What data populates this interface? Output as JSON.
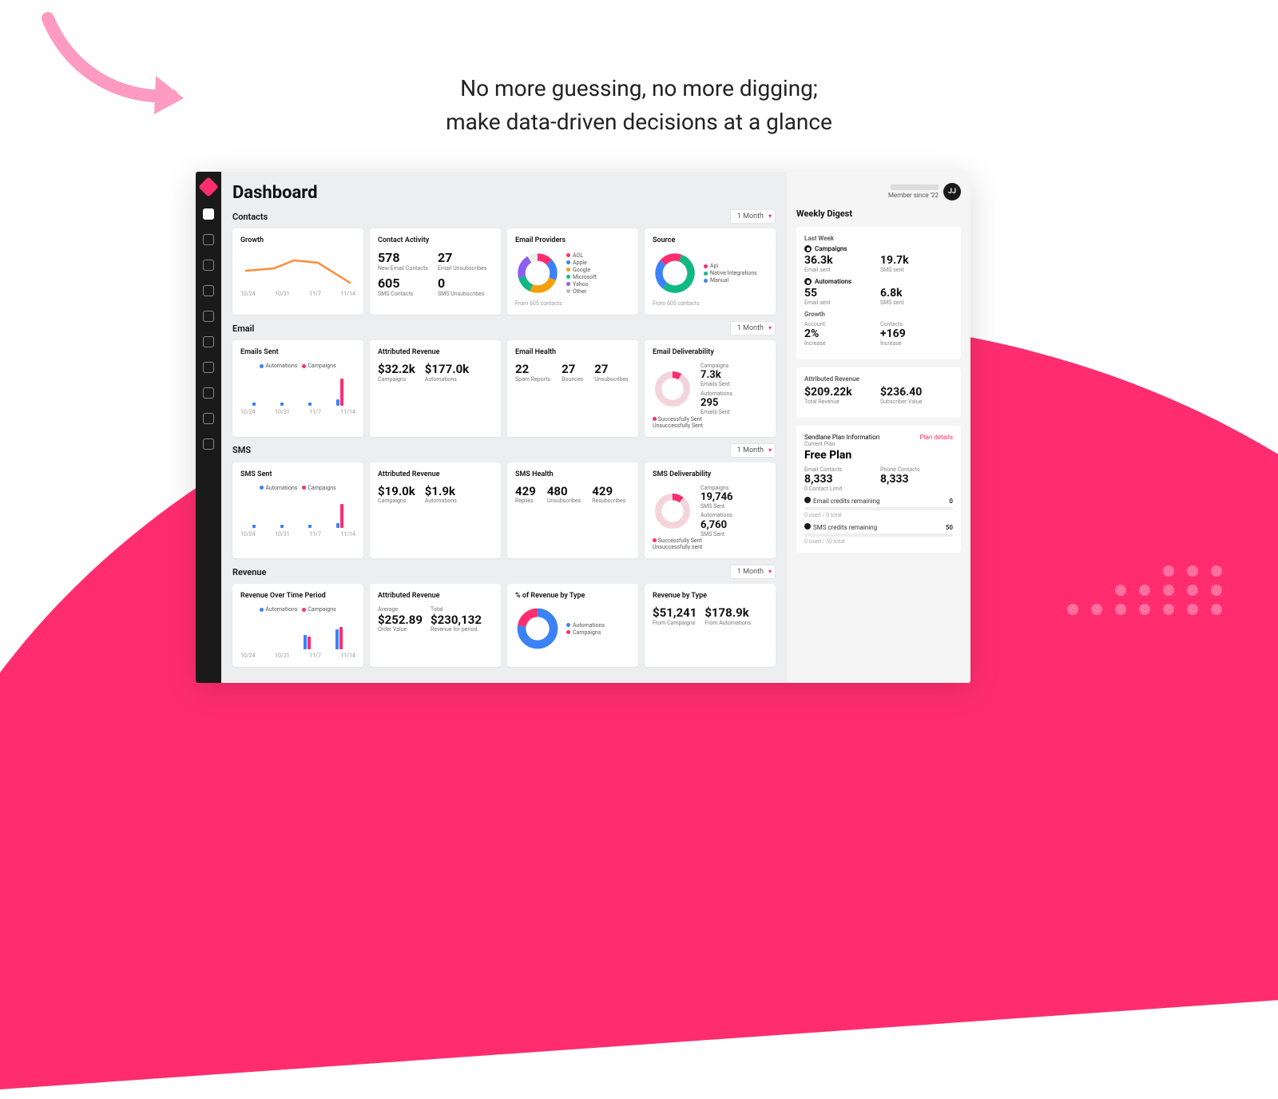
{
  "marketing": {
    "tagline_l1": "No more guessing, no more digging;",
    "tagline_l2": "make data-driven decisions at a glance"
  },
  "app": {
    "title": "Dashboard",
    "user": {
      "member_since": "Member since '22",
      "initials": "JJ"
    },
    "period_options": {
      "selected": "1 Month"
    },
    "sections": {
      "contacts": {
        "title": "Contacts",
        "growth": {
          "title": "Growth",
          "x": [
            "10/24",
            "10/31",
            "11/7",
            "11/14"
          ]
        },
        "activity": {
          "title": "Contact Activity",
          "stats": [
            {
              "v": "578",
              "l": "New Email Contacts"
            },
            {
              "v": "27",
              "l": "Email Unsubscribes"
            },
            {
              "v": "605",
              "l": "SMS Contacts"
            },
            {
              "v": "0",
              "l": "SMS Unsubscribes"
            }
          ]
        },
        "providers": {
          "title": "Email Providers",
          "legend": [
            "AOL",
            "Apple",
            "Google",
            "Microsoft",
            "Yahoo",
            "Other"
          ],
          "from": "From 605 contacts"
        },
        "source": {
          "title": "Source",
          "legend": [
            "Api",
            "Native Integrations",
            "Manual"
          ],
          "from": "From 605 contacts"
        }
      },
      "email": {
        "title": "Email",
        "sent": {
          "title": "Emails Sent",
          "legend": [
            "Automations",
            "Campaigns"
          ],
          "x": [
            "10/24",
            "10/31",
            "11/7",
            "11/14"
          ]
        },
        "revenue": {
          "title": "Attributed Revenue",
          "stats": [
            {
              "v": "$32.2k",
              "l": "Campaigns"
            },
            {
              "v": "$177.0k",
              "l": "Automations"
            }
          ]
        },
        "health": {
          "title": "Email Health",
          "stats": [
            {
              "v": "22",
              "l": "Spam Reports"
            },
            {
              "v": "27",
              "l": "Bounces"
            },
            {
              "v": "27",
              "l": "Unsubscribes"
            }
          ]
        },
        "deliv": {
          "title": "Email Deliverability",
          "legend": [
            "Successfully Sent",
            "Unsuccessfully Sent"
          ],
          "stats": [
            {
              "h": "Campaigns",
              "v": "7.3k",
              "l": "Emails Sent"
            },
            {
              "h": "Automations",
              "v": "295",
              "l": "Emails Sent"
            }
          ]
        }
      },
      "sms": {
        "title": "SMS",
        "sent": {
          "title": "SMS Sent",
          "legend": [
            "Automations",
            "Campaigns"
          ],
          "x": [
            "10/24",
            "10/31",
            "11/7",
            "11/14"
          ]
        },
        "revenue": {
          "title": "Attributed Revenue",
          "stats": [
            {
              "v": "$19.0k",
              "l": "Campaigns"
            },
            {
              "v": "$1.9k",
              "l": "Automations"
            }
          ]
        },
        "health": {
          "title": "SMS Health",
          "stats": [
            {
              "v": "429",
              "l": "Replies"
            },
            {
              "v": "480",
              "l": "Unsubscribes"
            },
            {
              "v": "429",
              "l": "Resubscribes"
            }
          ]
        },
        "deliv": {
          "title": "SMS Deliverability",
          "legend": [
            "Successfully Sent",
            "Unsuccessfully sent"
          ],
          "stats": [
            {
              "h": "Campaigns",
              "v": "19,746",
              "l": "SMS Sent"
            },
            {
              "h": "Automations",
              "v": "6,760",
              "l": "SMS Sent"
            }
          ]
        }
      },
      "revenue": {
        "title": "Revenue",
        "over_time": {
          "title": "Revenue Over Time Period",
          "legend": [
            "Automations",
            "Campaigns"
          ],
          "x": [
            "10/24",
            "10/31",
            "11/7",
            "11/14"
          ]
        },
        "attributed": {
          "title": "Attributed Revenue",
          "stats": [
            {
              "h": "Average",
              "v": "$252.89",
              "l": "Order Value"
            },
            {
              "h": "Total",
              "v": "$230,132",
              "l": "Revenue for period"
            }
          ]
        },
        "pct_type": {
          "title": "% of Revenue by Type",
          "legend": [
            "Automations",
            "Campaigns"
          ]
        },
        "by_type": {
          "title": "Revenue by Type",
          "stats": [
            {
              "v": "$51,241",
              "l": "From Campaigns"
            },
            {
              "v": "$178.9k",
              "l": "From Automations"
            }
          ]
        }
      }
    },
    "rail": {
      "digest_title": "Weekly Digest",
      "last_week": "Last Week",
      "campaigns": "Campaigns",
      "camp_stats": [
        {
          "v": "36.3k",
          "l": "Email sent"
        },
        {
          "v": "19.7k",
          "l": "SMS sent"
        }
      ],
      "automations": "Automations",
      "auto_stats": [
        {
          "v": "55",
          "l": "Email sent"
        },
        {
          "v": "6.8k",
          "l": "SMS sent"
        }
      ],
      "growth": "Growth",
      "growth_stats": [
        {
          "h": "Account",
          "v": "2%",
          "l": "Increase"
        },
        {
          "h": "Contacts",
          "v": "+169",
          "l": "Increase"
        }
      ],
      "attr_rev": "Attributed Revenue",
      "attr_stats": [
        {
          "v": "$209.22k",
          "l": "Total Revenue"
        },
        {
          "v": "$236.40",
          "l": "Subscriber Value"
        }
      ],
      "plan": {
        "head": "Sendlane Plan Information",
        "details": "Plan details",
        "current": "Current Plan",
        "name": "Free Plan",
        "cols": [
          {
            "h": "Email Contacts",
            "v": "8,333",
            "l": "0 Contact Limit"
          },
          {
            "h": "Phone Contacts",
            "v": "8,333",
            "l": ""
          }
        ],
        "email_credits": {
          "label": "Email credits remaining",
          "v": "0",
          "sub": "0 used / 0 total"
        },
        "sms_credits": {
          "label": "SMS credits remaining",
          "v": "50",
          "sub": "0 used / 50 total"
        }
      }
    }
  },
  "chart_data": [
    {
      "type": "line",
      "title": "Growth",
      "x": [
        "10/24",
        "10/31",
        "11/7",
        "11/14"
      ],
      "values": [
        60,
        62,
        72,
        40
      ],
      "ylim": [
        0,
        100
      ]
    },
    {
      "type": "pie",
      "title": "Email Providers",
      "categories": [
        "AOL",
        "Apple",
        "Google",
        "Microsoft",
        "Yahoo",
        "Other"
      ],
      "values": [
        12,
        18,
        25,
        15,
        20,
        10
      ]
    },
    {
      "type": "pie",
      "title": "Source",
      "categories": [
        "Api",
        "Native Integrations",
        "Manual"
      ],
      "values": [
        20,
        55,
        25
      ]
    },
    {
      "type": "bar",
      "title": "Emails Sent",
      "categories": [
        "10/24",
        "10/31",
        "11/7",
        "11/14"
      ],
      "series": [
        {
          "name": "Automations",
          "values": [
            5,
            5,
            5,
            10
          ]
        },
        {
          "name": "Campaigns",
          "values": [
            0,
            0,
            0,
            40
          ]
        }
      ]
    },
    {
      "type": "pie",
      "title": "Email Deliverability",
      "categories": [
        "Successfully Sent",
        "Unsuccessfully Sent"
      ],
      "values": [
        92,
        8
      ]
    },
    {
      "type": "bar",
      "title": "SMS Sent",
      "categories": [
        "10/24",
        "10/31",
        "11/7",
        "11/14"
      ],
      "series": [
        {
          "name": "Automations",
          "values": [
            5,
            5,
            5,
            8
          ]
        },
        {
          "name": "Campaigns",
          "values": [
            0,
            0,
            0,
            35
          ]
        }
      ]
    },
    {
      "type": "pie",
      "title": "SMS Deliverability",
      "categories": [
        "Successfully Sent",
        "Unsuccessfully sent"
      ],
      "values": [
        90,
        10
      ]
    },
    {
      "type": "bar",
      "title": "Revenue Over Time Period",
      "categories": [
        "10/24",
        "10/31",
        "11/7",
        "11/14"
      ],
      "series": [
        {
          "name": "Automations",
          "values": [
            0,
            0,
            20,
            28
          ]
        },
        {
          "name": "Campaigns",
          "values": [
            0,
            0,
            18,
            32
          ]
        }
      ]
    },
    {
      "type": "pie",
      "title": "% of Revenue by Type",
      "categories": [
        "Automations",
        "Campaigns"
      ],
      "values": [
        78,
        22
      ]
    }
  ]
}
